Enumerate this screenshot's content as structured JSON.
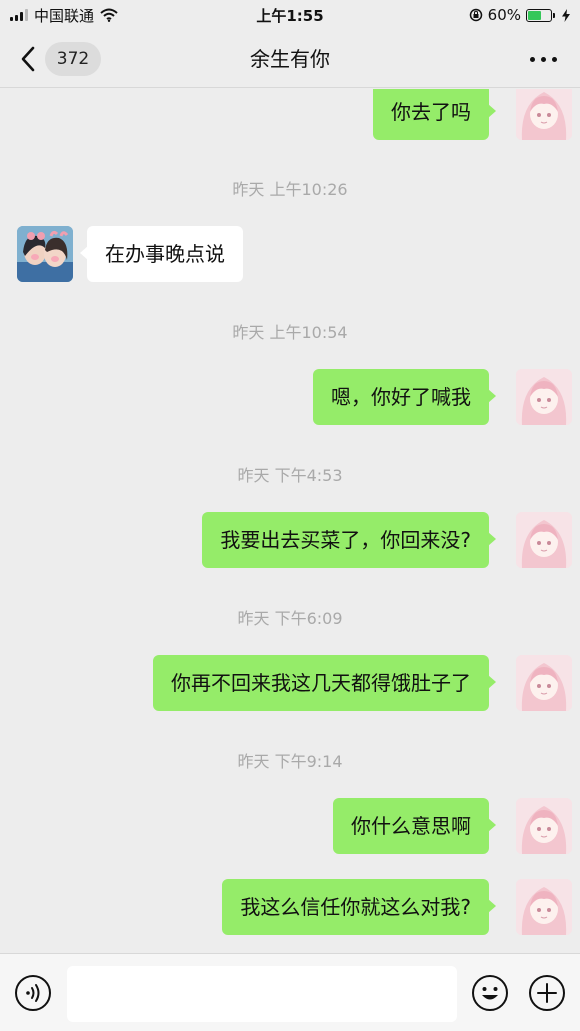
{
  "status_bar": {
    "carrier": "中国联通",
    "time": "上午1:55",
    "battery_percent": "60%",
    "battery_level": 0.6
  },
  "nav": {
    "unread_count": "372",
    "title": "余生有你"
  },
  "messages": [
    {
      "type": "text",
      "side": "me",
      "text": "你去了吗"
    },
    {
      "type": "time",
      "text": "昨天 上午10:26"
    },
    {
      "type": "text",
      "side": "other",
      "text": "在办事晚点说"
    },
    {
      "type": "time",
      "text": "昨天 上午10:54"
    },
    {
      "type": "text",
      "side": "me",
      "text": "嗯，你好了喊我"
    },
    {
      "type": "time",
      "text": "昨天 下午4:53"
    },
    {
      "type": "text",
      "side": "me",
      "text": "我要出去买菜了，你回来没?"
    },
    {
      "type": "time",
      "text": "昨天 下午6:09"
    },
    {
      "type": "text",
      "side": "me",
      "text": "你再不回来我这几天都得饿肚子了"
    },
    {
      "type": "time",
      "text": "昨天 下午9:14"
    },
    {
      "type": "text",
      "side": "me",
      "text": "你什么意思啊"
    },
    {
      "type": "text",
      "side": "me",
      "text": "我这么信任你就这么对我?"
    }
  ],
  "input": {
    "value": "",
    "icons": [
      "voice-icon",
      "emoji-icon",
      "plus-icon"
    ]
  },
  "colors": {
    "my_bubble": "#95ec69",
    "other_bubble": "#ffffff",
    "background": "#ededed"
  }
}
